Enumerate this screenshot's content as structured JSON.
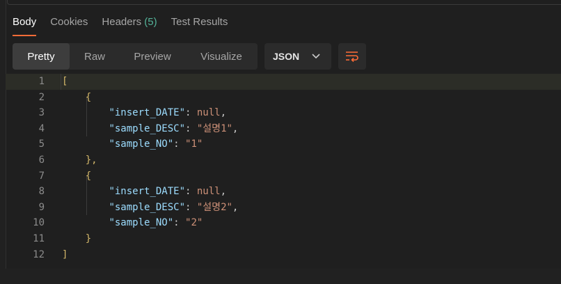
{
  "tabs": [
    {
      "label": "Body",
      "active": true
    },
    {
      "label": "Cookies",
      "active": false
    },
    {
      "label": "Headers",
      "count": "(5)",
      "active": false
    },
    {
      "label": "Test Results",
      "active": false
    }
  ],
  "view_modes": [
    {
      "label": "Pretty",
      "active": true
    },
    {
      "label": "Raw",
      "active": false
    },
    {
      "label": "Preview",
      "active": false
    },
    {
      "label": "Visualize",
      "active": false
    }
  ],
  "format": {
    "label": "JSON",
    "icon": "chevron-down-icon"
  },
  "wrap_button": {
    "icon": "wrap-lines-icon"
  },
  "colors": {
    "accent": "#ff6c37",
    "count": "#54b399",
    "key": "#9cdcfe",
    "string": "#ce9178"
  },
  "code": {
    "line_numbers": [
      "1",
      "2",
      "3",
      "4",
      "5",
      "6",
      "7",
      "8",
      "9",
      "10",
      "11",
      "12"
    ],
    "open_array": "[",
    "close_array": "]",
    "open_obj": "{",
    "close_obj_comma": "},",
    "close_obj": "}",
    "records": [
      {
        "k1": "\"insert_DATE\"",
        "v1": "null",
        "k2": "\"sample_DESC\"",
        "v2": "\"설명1\"",
        "k3": "\"sample_NO\"",
        "v3": "\"1\""
      },
      {
        "k1": "\"insert_DATE\"",
        "v1": "null",
        "k2": "\"sample_DESC\"",
        "v2": "\"설명2\"",
        "k3": "\"sample_NO\"",
        "v3": "\"2\""
      }
    ]
  }
}
